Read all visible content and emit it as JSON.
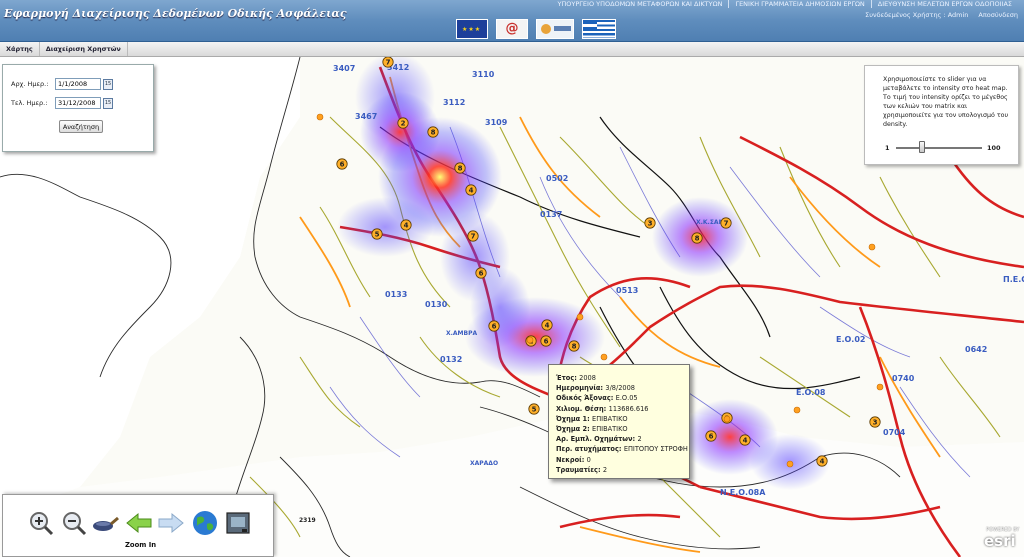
{
  "header": {
    "app_title": "Εφαρμογή Διαχείρισης Δεδομένων Οδικής Ασφάλειας",
    "ministries": [
      "ΥΠΟΥΡΓΕΙΟ ΥΠΟΔΟΜΩΝ ΜΕΤΑΦΟΡΩΝ ΚΑΙ ΔΙΚΤΥΩΝ",
      "ΓΕΝΙΚΗ ΓΡΑΜΜΑΤΕΙΑ ΔΗΜΟΣΙΩΝ ΕΡΓΩΝ",
      "ΔΙΕΥΘΥΝΣΗ ΜΕΛΕΤΩΝ ΕΡΓΩΝ ΟΔΟΠΟΙΙΑΣ"
    ],
    "user_label": "Συνδεδεμένος Χρήστης : Admin",
    "logout_label": "Αποσύνδεση",
    "logos": [
      "eu-flag-icon",
      "at-logo-icon",
      "ministry-logo-icon",
      "greek-flag-icon"
    ]
  },
  "menu": {
    "items": [
      "Χάρτης",
      "Διαχείριση Χρηστών"
    ]
  },
  "date_filter": {
    "start_label": "Αρχ. Ημερ.:",
    "start_value": "1/1/2008",
    "end_label": "Τελ. Ημερ.:",
    "end_value": "31/12/2008",
    "calendar_icon_text": "15",
    "search_label": "Αναζήτηση"
  },
  "heatmap_slider": {
    "help_text": "Χρησιμοποιείστε το slider για να μεταβάλετε το intensity στο heat map.  Το τιμή του intensity ορίζει το μέγεθος των κελιών του matrix και χρησιμοποιείτε για τον υπολογισμό του density.",
    "min_label": "1",
    "max_label": "100",
    "value_fraction": 0.3
  },
  "accident_popup": {
    "rows": [
      {
        "label": "Έτος:",
        "value": "2008"
      },
      {
        "label": "Ημερομηνία:",
        "value": "3/8/2008"
      },
      {
        "label": "Οδικός Άξονας:",
        "value": "Ε.Ο.05"
      },
      {
        "label": "Χιλιομ. Θέση:",
        "value": "113686.616"
      },
      {
        "label": "Όχημα 1:",
        "value": "ΕΠΙΒΑΤΙΚΟ"
      },
      {
        "label": "Όχημα 2:",
        "value": "ΕΠΙΒΑΤΙΚΟ"
      },
      {
        "label": "Αρ. Εμπλ. Οχημάτων:",
        "value": "2"
      },
      {
        "label": "Περ. ατυχήματος:",
        "value": "ΕΠΙΤΟΠΟΥ ΣΤΡΟΦΗ"
      },
      {
        "label": "Νεκροί:",
        "value": "0"
      },
      {
        "label": "Τραυματίες:",
        "value": "2"
      }
    ]
  },
  "map": {
    "accident_clusters": [
      "7",
      "2",
      "8",
      "8",
      "4",
      "6",
      "5",
      "4",
      "7",
      "6",
      "6",
      "4",
      "6",
      "8",
      "2",
      "8",
      "3",
      "7",
      "6",
      "4",
      "3",
      "2",
      "4",
      "5"
    ],
    "road_labels": [
      "3412",
      "3112",
      "3110",
      "3109",
      "3407",
      "3467",
      "0137",
      "0130",
      "0133",
      "0132",
      "0513",
      "0502",
      "0642",
      "0704",
      "0740",
      "Ε.Ο.08",
      "Ν.Ε.Ο.08Α",
      "Ε.Ο.02",
      "Π.Ε.Ο.",
      "Χ.ΑΜΒΡΑ",
      "ΧΑΡΑΔΟ",
      "Χ.Κ.ΣΑΝΣ",
      "2319"
    ],
    "heat_colors": {
      "low": "#3a3aff",
      "mid": "#ff2020",
      "high": "#ffff60"
    }
  },
  "toolbar": {
    "tools": [
      "zoom-in-icon",
      "zoom-out-icon",
      "pan-icon",
      "back-arrow-icon",
      "forward-arrow-icon",
      "full-extent-globe-icon",
      "print-icon"
    ],
    "active_tool_label": "Zoom In"
  },
  "attribution": {
    "logo": "esri",
    "small": "POWERED BY"
  }
}
